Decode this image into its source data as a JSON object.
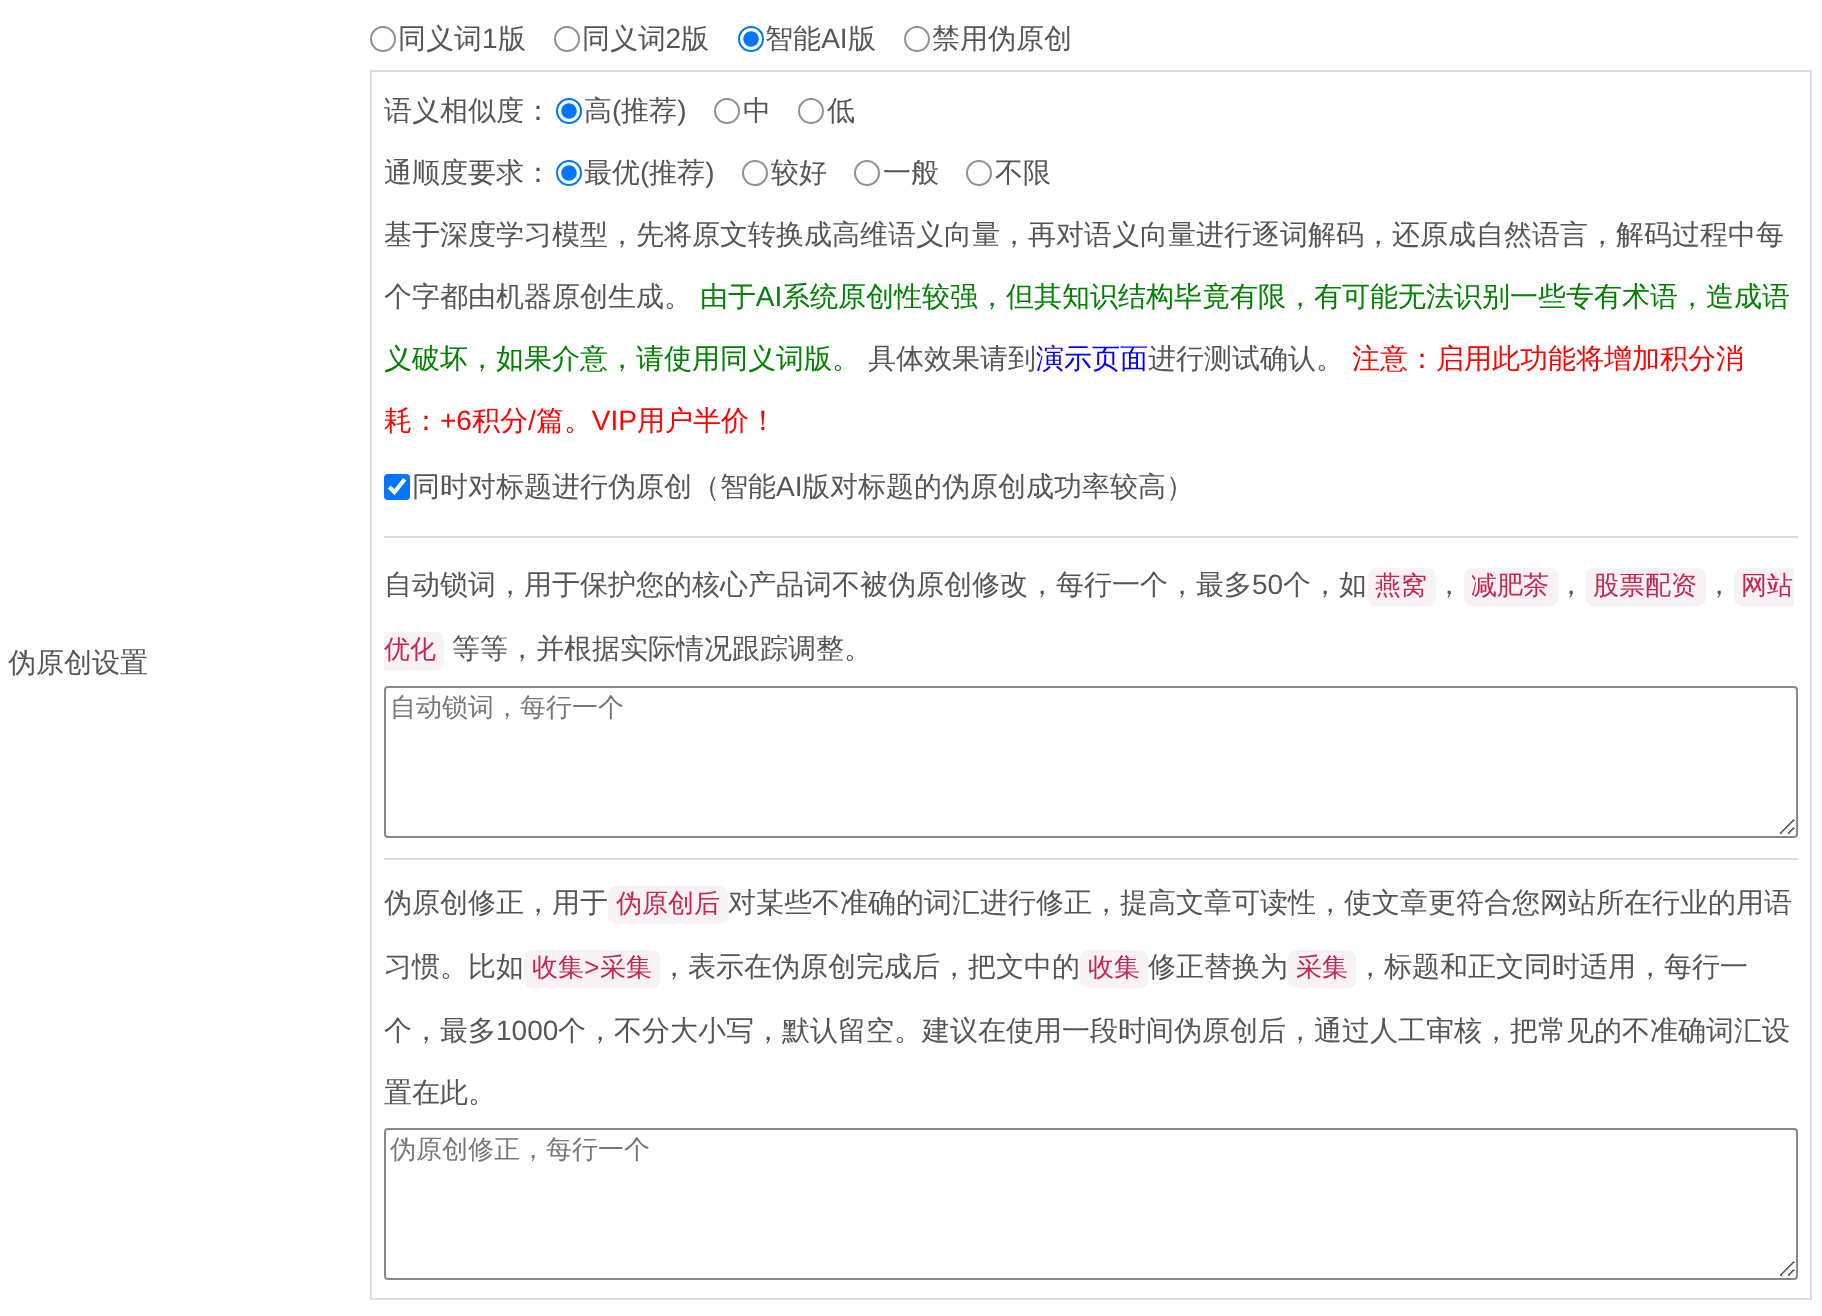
{
  "section_label": "伪原创设置",
  "version_options": [
    {
      "label": "同义词1版",
      "selected": false
    },
    {
      "label": "同义词2版",
      "selected": false
    },
    {
      "label": "智能AI版",
      "selected": true
    },
    {
      "label": "禁用伪原创",
      "selected": false
    }
  ],
  "settings_panel": {
    "similarity": {
      "label": "语义相似度：",
      "options": [
        {
          "label": "高(推荐)",
          "selected": true
        },
        {
          "label": "中",
          "selected": false
        },
        {
          "label": "低",
          "selected": false
        }
      ]
    },
    "fluency": {
      "label": "通顺度要求：",
      "options": [
        {
          "label": "最优(推荐)",
          "selected": true
        },
        {
          "label": "较好",
          "selected": false
        },
        {
          "label": "一般",
          "selected": false
        },
        {
          "label": "不限",
          "selected": false
        }
      ]
    },
    "description": [
      {
        "kind": "plain",
        "text": "基于深度学习模型，先将原文转换成高维语义向量，再对语义向量进行逐词解码，还原成自然语言，解码过程中每个字都由机器原创生成。 "
      },
      {
        "kind": "green",
        "text": "由于AI系统原创性较强，但其知识结构毕竟有限，有可能无法识别一些专有术语，造成语义破坏，如果介意，请使用同义词版。"
      },
      {
        "kind": "plain",
        "text": " 具体效果请到"
      },
      {
        "kind": "link",
        "text": "演示页面"
      },
      {
        "kind": "plain",
        "text": "进行测试确认。 "
      },
      {
        "kind": "red",
        "text": "注意：启用此功能将增加积分消耗：+6积分/篇。VIP用户半价！"
      }
    ],
    "title_checkbox": {
      "label": "同时对标题进行伪原创（智能AI版对标题的伪原创成功率较高）",
      "checked": true
    },
    "lock_words": {
      "description": [
        {
          "kind": "plain",
          "text": "自动锁词，用于保护您的核心产品词不被伪原创修改，每行一个，最多50个，如"
        },
        {
          "kind": "tag",
          "text": "燕窝"
        },
        {
          "kind": "plain",
          "text": "，"
        },
        {
          "kind": "tag",
          "text": "减肥茶"
        },
        {
          "kind": "plain",
          "text": "，"
        },
        {
          "kind": "tag",
          "text": "股票配资"
        },
        {
          "kind": "plain",
          "text": "，"
        },
        {
          "kind": "tag",
          "text": "网站优化"
        },
        {
          "kind": "plain",
          "text": " 等等，并根据实际情况跟踪调整。"
        }
      ],
      "placeholder": "自动锁词，每行一个"
    },
    "corrections": {
      "description": [
        {
          "kind": "plain",
          "text": "伪原创修正，用于"
        },
        {
          "kind": "tag",
          "text": "伪原创后"
        },
        {
          "kind": "plain",
          "text": "对某些不准确的词汇进行修正，提高文章可读性，使文章更符合您网站所在行业的用语习惯。比如"
        },
        {
          "kind": "tag",
          "text": "收集>采集"
        },
        {
          "kind": "plain",
          "text": "，表示在伪原创完成后，把文中的"
        },
        {
          "kind": "tag",
          "text": "收集"
        },
        {
          "kind": "plain",
          "text": "修正替换为"
        },
        {
          "kind": "tag",
          "text": "采集"
        },
        {
          "kind": "plain",
          "text": "，标题和正文同时适用，每行一个，最多1000个，不分大小写，默认留空。建议在使用一段时间伪原创后，通过人工审核，把常见的不准确词汇设置在此。"
        }
      ],
      "placeholder": "伪原创修正，每行一个"
    }
  }
}
